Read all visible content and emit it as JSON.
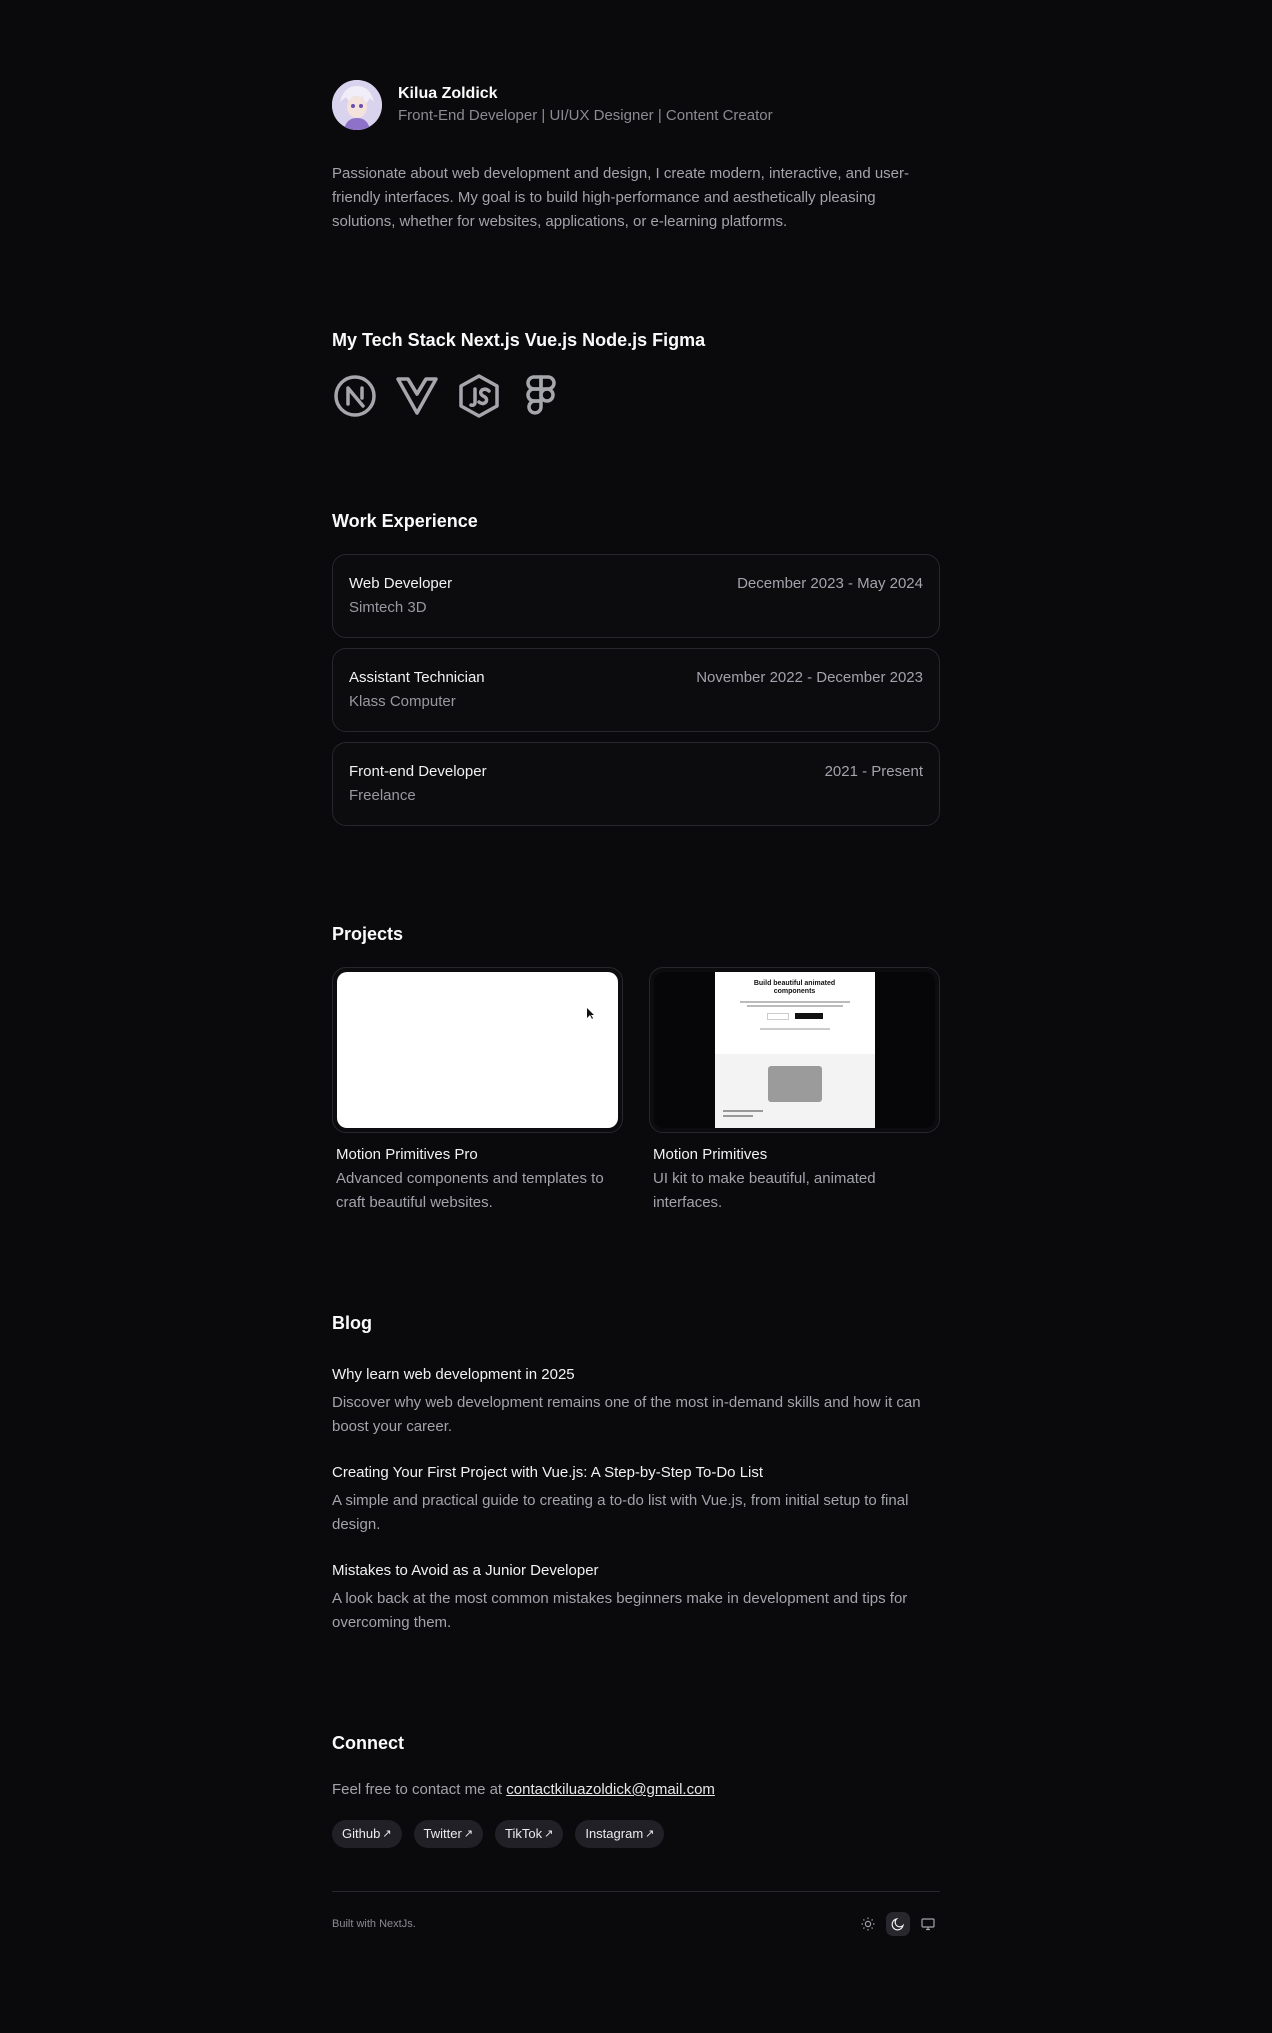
{
  "profile": {
    "name": "Kilua Zoldick",
    "role": "Front-End Developer | UI/UX Designer | Content Creator",
    "bio": "Passionate about web development and design, I create modern, interactive, and user-friendly interfaces. My goal is to build high-performance and aesthetically pleasing solutions, whether for websites, applications, or e-learning platforms."
  },
  "tech": {
    "title": "My Tech Stack Next.js Vue.js Node.js Figma",
    "icons": [
      "nextjs-icon",
      "vuejs-icon",
      "nodejs-icon",
      "figma-icon"
    ]
  },
  "work": {
    "title": "Work Experience",
    "jobs": [
      {
        "title": "Web Developer",
        "company": "Simtech 3D",
        "dates": "December 2023 - May 2024"
      },
      {
        "title": "Assistant Technician",
        "company": "Klass Computer",
        "dates": "November 2022 - December 2023"
      },
      {
        "title": "Front-end Developer",
        "company": "Freelance",
        "dates": "2021 - Present"
      }
    ]
  },
  "projects": {
    "title": "Projects",
    "items": [
      {
        "name": "Motion Primitives Pro",
        "desc": "Advanced components and templates to craft beautiful websites."
      },
      {
        "name": "Motion Primitives",
        "desc": "UI kit to make beautiful, animated interfaces.",
        "preview_heading": "Build beautiful animated components"
      }
    ]
  },
  "blog": {
    "title": "Blog",
    "posts": [
      {
        "title": "Why learn web development in 2025",
        "desc": "Discover why web development remains one of the most in-demand skills and how it can boost your career."
      },
      {
        "title": "Creating Your First Project with Vue.js: A Step-by-Step To-Do List",
        "desc": "A simple and practical guide to creating a to-do list with Vue.js, from initial setup to final design."
      },
      {
        "title": "Mistakes to Avoid as a Junior Developer",
        "desc": "A look back at the most common mistakes beginners make in development and tips for overcoming them."
      }
    ]
  },
  "connect": {
    "title": "Connect",
    "text": "Feel free to contact me at",
    "email": "contactkiluazoldick@gmail.com",
    "socials": [
      "Github",
      "Twitter",
      "TikTok",
      "Instagram"
    ]
  },
  "footer": {
    "built": "Built with NextJs.",
    "theme_options": [
      "light-icon",
      "dark-icon",
      "system-icon"
    ],
    "active_theme": "dark"
  },
  "colors": {
    "background": "#0a0a0c",
    "card_border": "#27272d",
    "text_primary": "#fafafa",
    "text_muted": "#a3a3ab",
    "chip_bg": "#202026"
  }
}
